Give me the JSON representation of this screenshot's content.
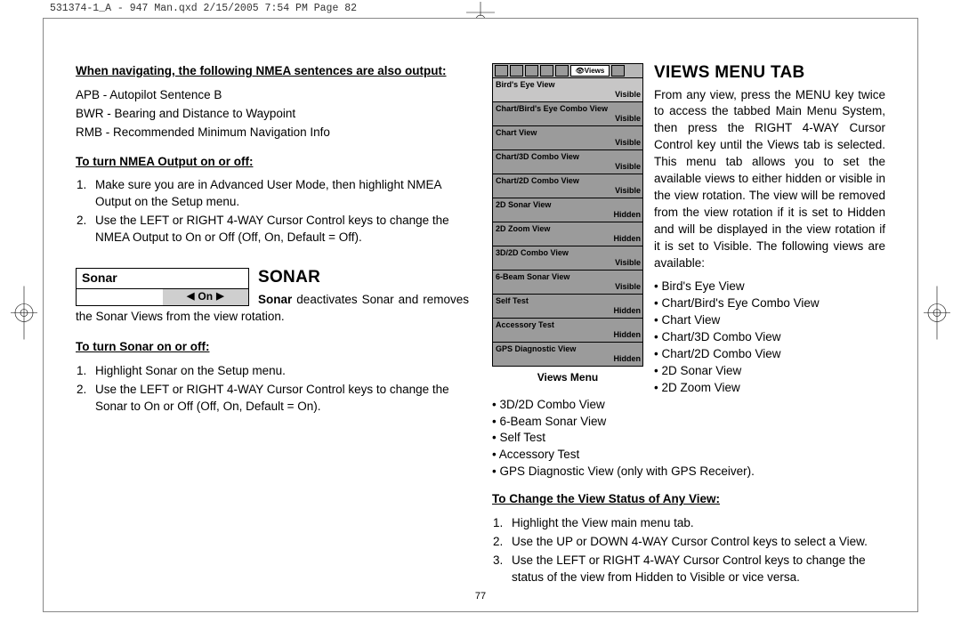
{
  "slug": "531374-1_A - 947 Man.qxd  2/15/2005  7:54 PM  Page 82",
  "page_number": "77",
  "left": {
    "nmea_heading": "When navigating, the following NMEA sentences are also output:",
    "nmea_lines": {
      "l1": "APB - Autopilot Sentence B",
      "l2": "BWR - Bearing and Distance to Waypoint",
      "l3": "RMB - Recommended Minimum Navigation Info"
    },
    "nmea_turn_heading": "To turn NMEA Output on or off:",
    "nmea_steps": {
      "s1": "Make sure you are in Advanced User Mode, then highlight NMEA Output on the Setup menu.",
      "s2": "Use the LEFT or RIGHT 4-WAY Cursor Control keys to change the NMEA Output to On or Off (Off, On, Default = Off)."
    },
    "sonar_ui_label": "Sonar",
    "sonar_ui_value": "On",
    "sonar_title": "Sonar",
    "sonar_lead_bold": "Sonar",
    "sonar_lead_rest": " deactivates Sonar and removes the Sonar Views from the view rotation.",
    "sonar_turn_heading": "To turn Sonar on or off:",
    "sonar_steps": {
      "s1": "Highlight Sonar on the Setup menu.",
      "s2": "Use the LEFT or RIGHT 4-WAY Cursor Control keys to change the Sonar to On or Off (Off, On, Default = On)."
    }
  },
  "right": {
    "views_tab_label": "Views",
    "views": [
      {
        "label": "Bird's Eye View",
        "status": "Visible",
        "sel": true
      },
      {
        "label": "Chart/Bird's Eye Combo View",
        "status": "Visible"
      },
      {
        "label": "Chart View",
        "status": "Visible"
      },
      {
        "label": "Chart/3D Combo View",
        "status": "Visible"
      },
      {
        "label": "Chart/2D Combo View",
        "status": "Visible"
      },
      {
        "label": "2D Sonar View",
        "status": "Hidden"
      },
      {
        "label": "2D Zoom View",
        "status": "Hidden"
      },
      {
        "label": "3D/2D Combo View",
        "status": "Visible"
      },
      {
        "label": "6-Beam Sonar View",
        "status": "Visible"
      },
      {
        "label": "Self Test",
        "status": "Hidden"
      },
      {
        "label": "Accessory Test",
        "status": "Hidden"
      },
      {
        "label": "GPS Diagnostic View",
        "status": "Hidden"
      }
    ],
    "views_caption": "Views Menu",
    "views_title": "Views Menu Tab",
    "views_body": "From any view, press the MENU key twice to access the tabbed Main Menu System, then press the RIGHT 4-WAY Cursor Control key until the Views tab is selected. This menu tab allows you to set the available views to either hidden or visible in the view rotation. The view will be removed from the view rotation if it is set to Hidden and will be displayed in the view rotation if it is set to Visible. The following views are available:",
    "bullets": {
      "b1": "Bird's Eye View",
      "b2": "Chart/Bird's Eye Combo View",
      "b3": "Chart View",
      "b4": "Chart/3D Combo View",
      "b5": "Chart/2D Combo View",
      "b6": "2D Sonar View",
      "b7": "2D Zoom View",
      "b8": "3D/2D Combo View",
      "b9": "6-Beam Sonar View",
      "b10": "Self Test",
      "b11": "Accessory Test",
      "b12": "GPS Diagnostic View (only with GPS Receiver)."
    },
    "change_heading": "To Change the View Status of Any View:",
    "change_steps": {
      "s1": "Highlight the View main menu tab.",
      "s2": "Use the UP or DOWN 4-WAY Cursor Control keys to select a View.",
      "s3": "Use the LEFT or RIGHT 4-WAY Cursor Control keys to change the status of the view from Hidden to Visible or vice versa."
    }
  }
}
